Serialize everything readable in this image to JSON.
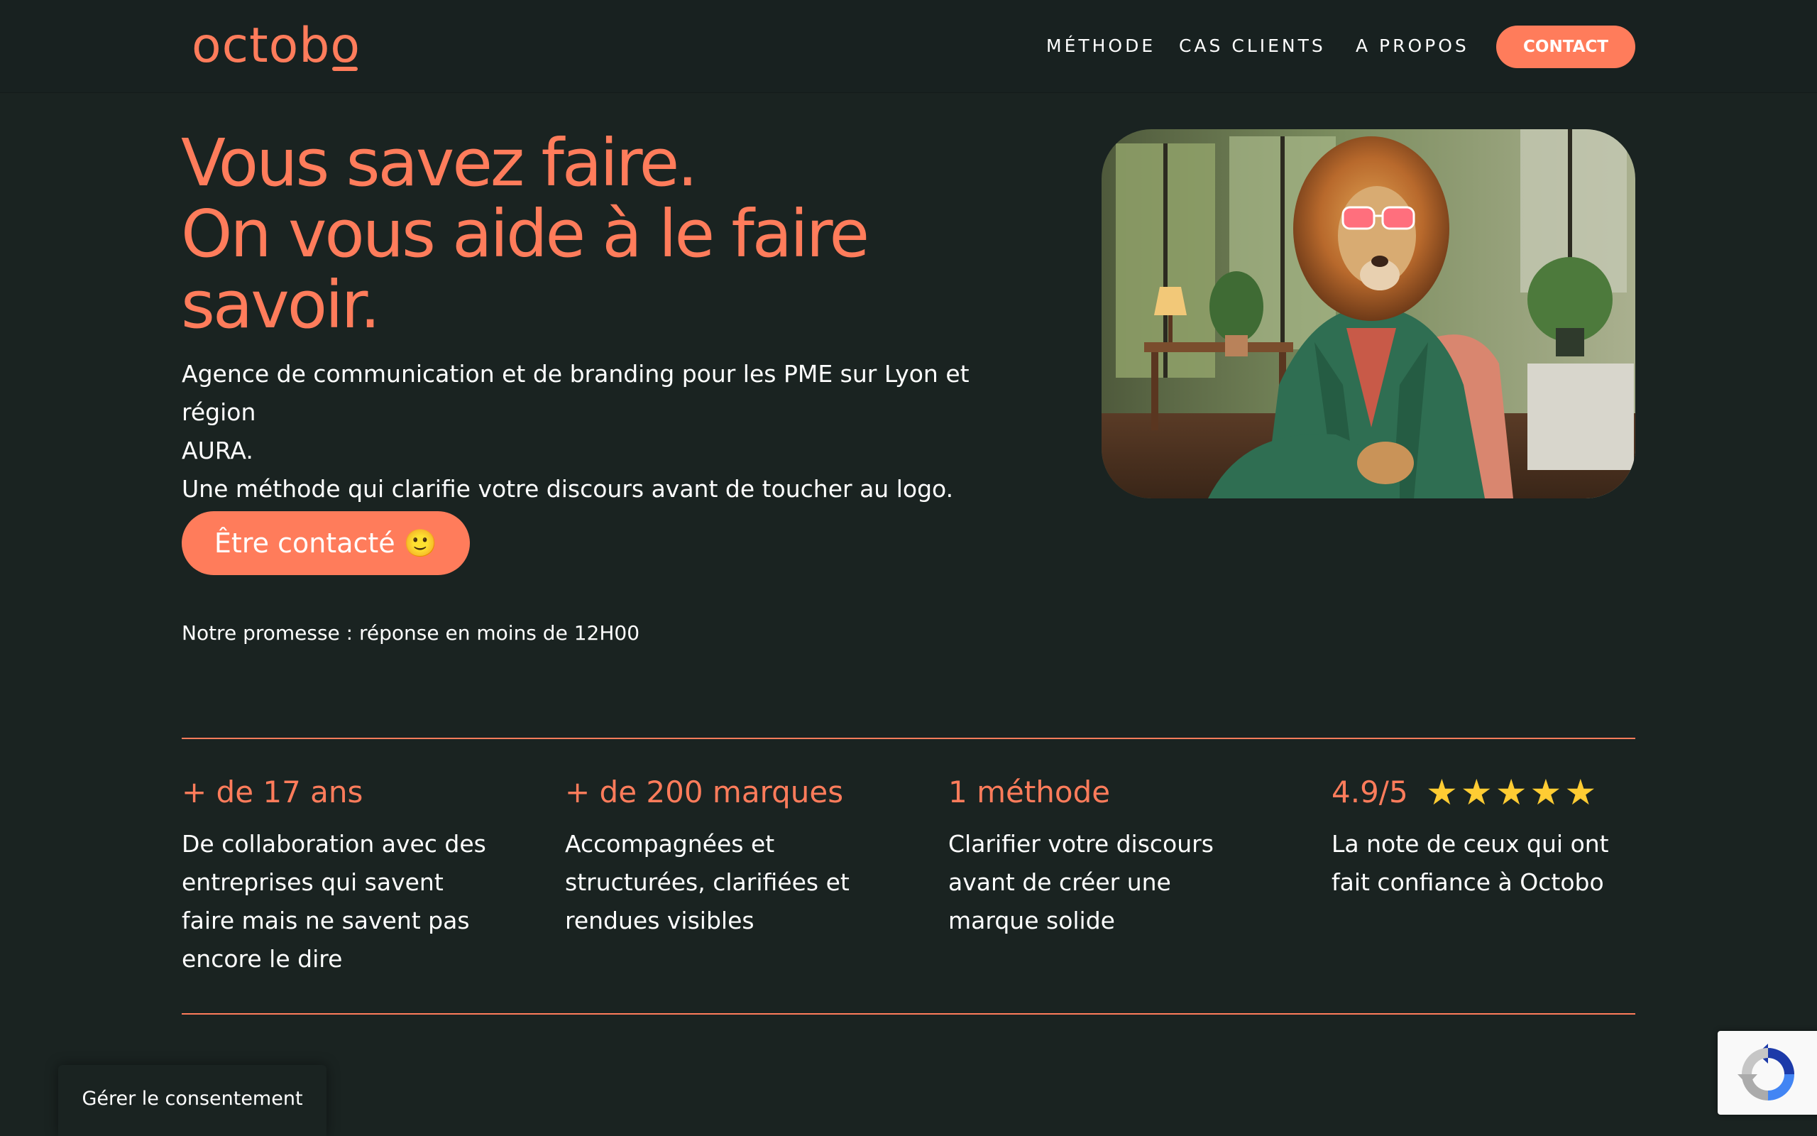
{
  "header": {
    "logo": "octobo",
    "nav": {
      "methode": "MÉTHODE",
      "cas_clients": "CAS CLIENTS",
      "a_propos": "A PROPOS"
    },
    "contact_label": "CONTACT"
  },
  "hero": {
    "title_lines": [
      "Vous savez faire.",
      "On vous aide à le faire",
      "savoir."
    ],
    "subtitle_lines": [
      "Agence de communication et de branding pour les PME sur Lyon et région",
      "AURA.",
      "Une méthode qui clarifie votre discours avant de toucher au logo."
    ],
    "cta_label": "Être contacté 🙂",
    "promise": "Notre promesse : réponse en moins de 12H00",
    "image": "lion-in-green-suit-illustration"
  },
  "stats": [
    {
      "title": "+ de 17 ans",
      "description": "De collaboration avec des entreprises qui savent faire mais ne savent pas encore le dire"
    },
    {
      "title": "+ de 200 marques",
      "description": "Accompagnées et structurées, clarifiées et rendues visibles"
    },
    {
      "title": "1 méthode",
      "description": "Clarifier votre discours avant de créer une marque solide"
    },
    {
      "title": "4.9/5",
      "stars": 5,
      "description": "La note de ceux qui ont fait confiance à Octobo"
    }
  ],
  "consent": {
    "label": "Gérer le consentement"
  },
  "recaptcha": {
    "icon": "recaptcha-icon"
  },
  "colors": {
    "background": "#1a2321",
    "accent": "#ff7c5b",
    "star": "#ffcc33"
  }
}
